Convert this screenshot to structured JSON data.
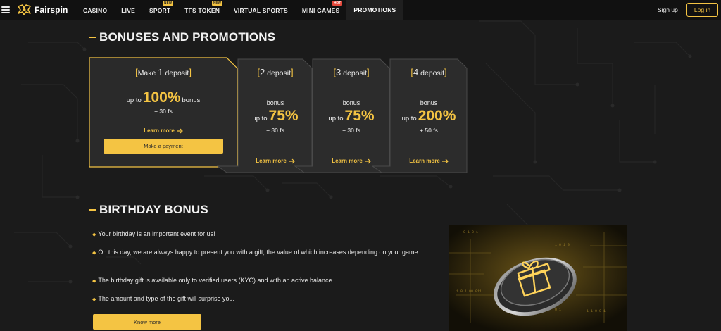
{
  "header": {
    "logo_text": "Fairspin",
    "nav": [
      {
        "label": "CASINO",
        "badge": ""
      },
      {
        "label": "LIVE",
        "badge": ""
      },
      {
        "label": "SPORT",
        "badge": "NEW"
      },
      {
        "label": "TFS TOKEN",
        "badge": "NEW"
      },
      {
        "label": "VIRTUAL SPORTS",
        "badge": ""
      },
      {
        "label": "MINI GAMES",
        "badge": "HOT"
      },
      {
        "label": "PROMOTIONS",
        "badge": ""
      }
    ],
    "active_nav": "PROMOTIONS",
    "signup_label": "Sign up",
    "login_label": "Log in"
  },
  "bonuses": {
    "title": "BONUSES AND PROMOTIONS",
    "cards": [
      {
        "title_prefix": "Make",
        "number": "1",
        "title_word": "deposit",
        "up_to": "up to",
        "amount": "100%",
        "bonus_word": "bonus",
        "fs": "+ 30 fs",
        "learn": "Learn more",
        "action": "Make a payment",
        "highlighted": true
      },
      {
        "title_prefix": "",
        "number": "2",
        "title_word": "deposit",
        "up_to": "up to",
        "amount": "75%",
        "bonus_word": "bonus",
        "fs": "+ 30 fs",
        "learn": "Learn more",
        "highlighted": false
      },
      {
        "title_prefix": "",
        "number": "3",
        "title_word": "deposit",
        "up_to": "up to",
        "amount": "75%",
        "bonus_word": "bonus",
        "fs": "+ 30 fs",
        "learn": "Learn more",
        "highlighted": false
      },
      {
        "title_prefix": "",
        "number": "4",
        "title_word": "deposit",
        "up_to": "up to",
        "amount": "200%",
        "bonus_word": "bonus",
        "fs": "+ 50 fs",
        "learn": "Learn more",
        "highlighted": false
      }
    ]
  },
  "birthday": {
    "title": "BIRTHDAY BONUS",
    "items": [
      "Your birthday is an important event for us!",
      "On this day, we are always happy to present you with a gift, the value of which increases depending on your game.",
      "The birthday gift is available only to verified users (KYC) and with an active balance.",
      "The amount and type of the gift will surprise you."
    ],
    "button_label": "Know more",
    "image_icon": "gift-coin-icon"
  },
  "colors": {
    "accent": "#f4c443",
    "background": "#1b1b1b",
    "card": "#2c2c2c",
    "hot_badge": "#e5483b"
  }
}
